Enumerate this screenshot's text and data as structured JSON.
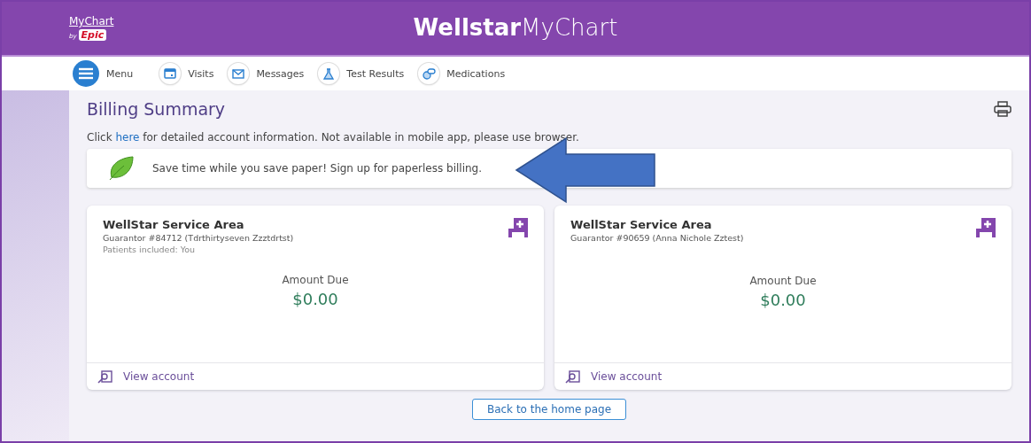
{
  "header": {
    "logo_top": "MyChart",
    "logo_by": "by",
    "logo_brand": "Epic",
    "brand_bold": "Wellstar",
    "brand_light": "MyChart"
  },
  "nav": [
    {
      "label": "Menu",
      "kind": "menu"
    },
    {
      "label": "Visits",
      "kind": "calendar"
    },
    {
      "label": "Messages",
      "kind": "mail"
    },
    {
      "label": "Test Results",
      "kind": "flask"
    },
    {
      "label": "Medications",
      "kind": "pills"
    }
  ],
  "page": {
    "title": "Billing Summary",
    "info_before": "Click ",
    "info_link": "here",
    "info_after": " for detailed account information. Not available in mobile app, please use browser.",
    "banner": "Save time while you save paper! Sign up for paperless billing."
  },
  "accounts": [
    {
      "name": "WellStar Service Area",
      "guarantor": "Guarantor #84712 (Tdrthirtyseven Zzztdrtst)",
      "patients": "Patients included: You",
      "amount_label": "Amount Due",
      "amount": "$0.00",
      "action": "View account"
    },
    {
      "name": "WellStar Service Area",
      "guarantor": "Guarantor #90659 (Anna Nichole Zztest)",
      "amount_label": "Amount Due",
      "amount": "$0.00",
      "action": "View account"
    }
  ],
  "back_button": "Back to the home page"
}
